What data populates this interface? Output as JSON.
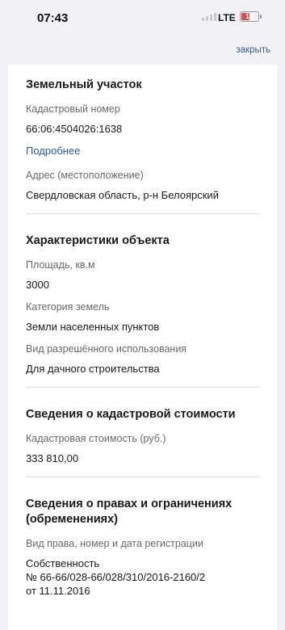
{
  "status_bar": {
    "time": "07:43",
    "network": "LTE",
    "battery_level": "10",
    "battery_color": "#e04a4a"
  },
  "header": {
    "close_label": "закрыть"
  },
  "sections": {
    "land": {
      "title": "Земельный участок",
      "cadastral_label": "Кадастровый номер",
      "cadastral_value": "66:06:4504026:1638",
      "more_link": "Подробнее",
      "address_label": "Адрес (местоположение)",
      "address_value": "Свердловская область, р-н Белоярский"
    },
    "characteristics": {
      "title": "Характеристики объекта",
      "area_label": "Площадь, кв.м",
      "area_value": "3000",
      "category_label": "Категория земель",
      "category_value": "Земли населенных пунктов",
      "use_label": "Вид разрешённого использования",
      "use_value": "Для дачного строительства"
    },
    "cost": {
      "title": "Сведения о кадастровой стоимости",
      "cost_label": "Кадастровая стоимость (руб.)",
      "cost_value": "333 810,00"
    },
    "rights": {
      "title": "Сведения о правах и ограничениях (обременениях)",
      "reg_label": "Вид права, номер и дата регистрации",
      "reg_value_1": "Собственность",
      "reg_value_2": "№ 66-66/028-66/028/310/2016-2160/2",
      "reg_value_3": "от 11.11.2016"
    }
  },
  "colors": {
    "link": "#2b5b9c",
    "accent": "#3b5998"
  }
}
